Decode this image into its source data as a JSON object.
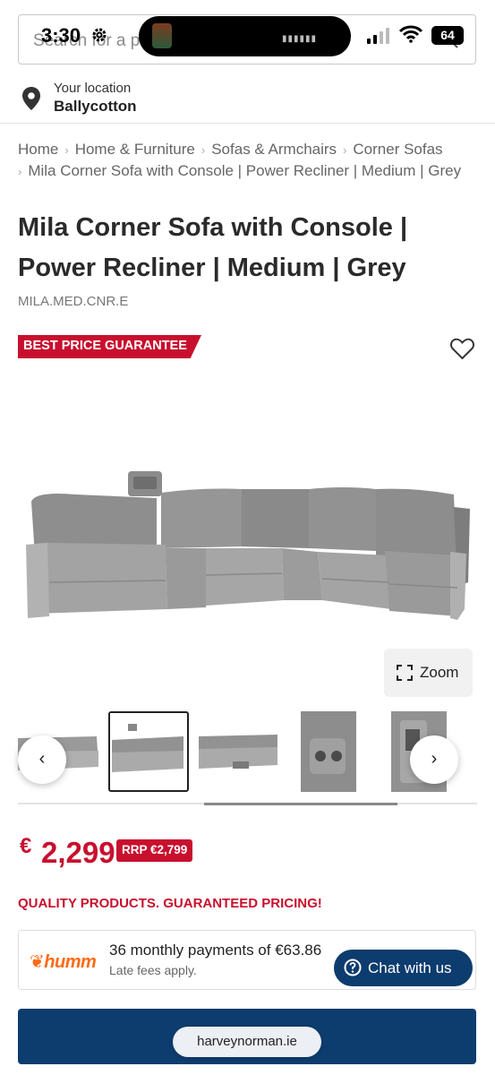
{
  "status_bar": {
    "time": "3:30",
    "battery": "64"
  },
  "search": {
    "placeholder": "Search for a p"
  },
  "location": {
    "label": "Your location",
    "value": "Ballycotton"
  },
  "breadcrumb": {
    "items": [
      "Home",
      "Home & Furniture",
      "Sofas & Armchairs",
      "Corner Sofas",
      "Mila Corner Sofa with Console | Power Recliner | Medium | Grey"
    ]
  },
  "product": {
    "title_line1": "Mila Corner Sofa with Console |",
    "title_line2": "Power Recliner | Medium | Grey",
    "sku": "MILA.MED.CNR.E",
    "badge": "BEST PRICE GUARANTEE",
    "zoom_label": "Zoom",
    "currency": "€",
    "price": "2,299",
    "rrp": "RRP €2,799",
    "guarantee": "QUALITY PRODUCTS. GUARANTEED PRICING!",
    "selected_thumbnail_index": 1,
    "carousel_scroll_fraction": 0.42
  },
  "humm": {
    "logo": "humm",
    "text": "36 monthly payments of €63.86",
    "subtext": "Late fees apply."
  },
  "chat": {
    "label": "Chat with us"
  },
  "browser": {
    "url": "harveynorman.ie"
  },
  "colors": {
    "brand_red": "#c8102e",
    "brand_navy": "#0d3c6e",
    "humm_orange": "#ff6a13"
  },
  "icons": [
    "settings-gear-icon",
    "signal-icon",
    "wifi-icon",
    "search-icon",
    "location-pin-icon",
    "heart-icon",
    "zoom-icon",
    "chevron-left-icon",
    "chevron-right-icon",
    "help-circle-icon"
  ]
}
